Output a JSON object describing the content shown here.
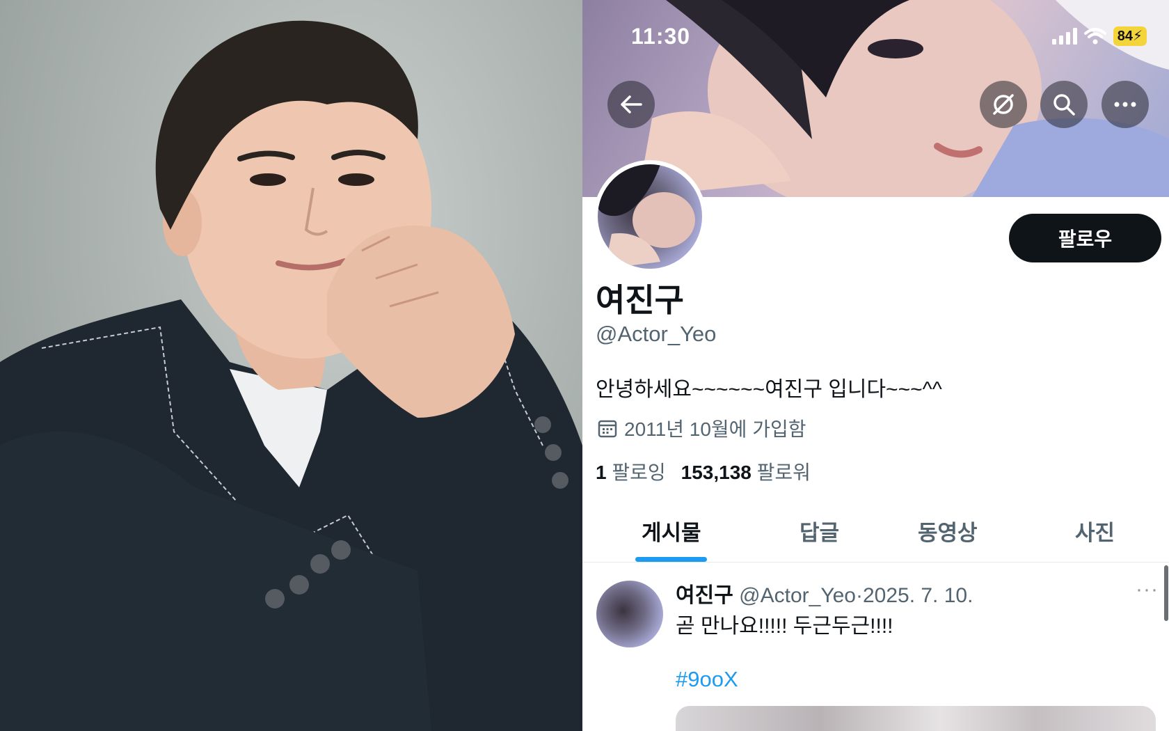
{
  "status_bar": {
    "time": "11:30",
    "battery": "84",
    "icons": [
      "signal-icon",
      "wifi-icon",
      "battery-charging-icon"
    ]
  },
  "banner_nav": {
    "back_icon": "arrow-left-icon",
    "grok_icon": "grok-icon",
    "search_icon": "search-icon",
    "more_icon": "more-horizontal-icon"
  },
  "profile": {
    "name": "여진구",
    "handle": "@Actor_Yeo",
    "bio": "안녕하세요~~~~~~여진구 입니다~~~^^",
    "joined": "2011년 10월에 가입함",
    "following_count": "1",
    "following_label": "팔로잉",
    "followers_count": "153,138",
    "followers_label": "팔로워",
    "follow_button": "팔로우"
  },
  "tabs": [
    {
      "label": "게시물",
      "active": true
    },
    {
      "label": "답글",
      "active": false
    },
    {
      "label": "동영상",
      "active": false
    },
    {
      "label": "사진",
      "active": false
    }
  ],
  "post": {
    "name": "여진구",
    "handle": "@Actor_Yeo",
    "separator": "·",
    "date": "2025. 7. 10.",
    "text": "곧 만나요!!!!! 두근두근!!!!",
    "hashtag": "#9ooX",
    "more": "···"
  },
  "colors": {
    "accent": "#1d9bf0",
    "button_dark": "#0f1419",
    "secondary_text": "#536471",
    "battery": "#f3d43a"
  }
}
